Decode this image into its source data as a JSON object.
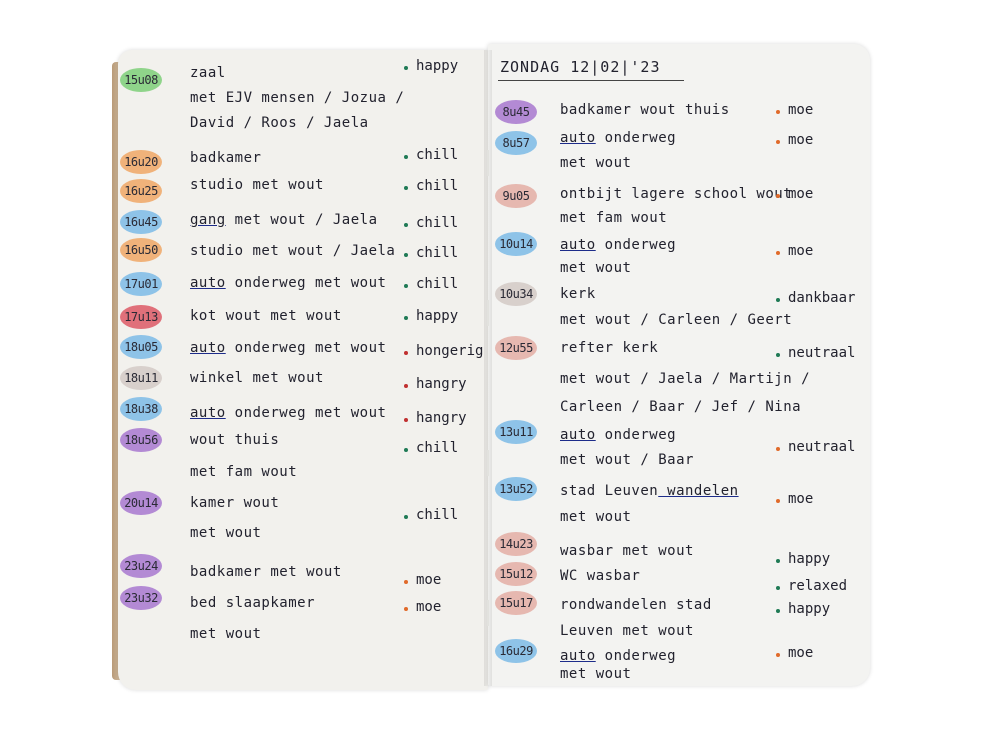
{
  "header": {
    "date": "ZONDAG   12|02|'23"
  },
  "colors": {
    "green": "#8fd48a",
    "orange": "#f0b27a",
    "blue": "#8ec3e8",
    "red": "#e0707a",
    "purple": "#b38ad4",
    "pink": "#e6b8b0",
    "grey": "#d8d0cc",
    "dot_green": "#1f7a55",
    "dot_orange": "#e06a2a",
    "dot_red": "#c03030"
  },
  "left_page": [
    {
      "time": "15u08",
      "lines": [
        "zaal",
        "met EJV mensen / Jozua /",
        "David / Roos / Jaela"
      ],
      "mood": "happy"
    },
    {
      "time": "16u20",
      "lines": [
        "badkamer"
      ],
      "mood": "chill"
    },
    {
      "time": "16u25",
      "lines": [
        "studio met wout"
      ],
      "mood": "chill"
    },
    {
      "time": "16u45",
      "lines": [
        "gang met wout / Jaela"
      ],
      "mood": "chill"
    },
    {
      "time": "16u50",
      "lines": [
        "studio met wout / Jaela"
      ],
      "mood": "chill"
    },
    {
      "time": "17u01",
      "lines": [
        "auto onderweg met wout"
      ],
      "mood": "chill"
    },
    {
      "time": "17u13",
      "lines": [
        "kot wout met wout"
      ],
      "mood": "happy"
    },
    {
      "time": "18u05",
      "lines": [
        "auto onderweg met wout"
      ],
      "mood": "hongerig"
    },
    {
      "time": "18u11",
      "lines": [
        "winkel met wout"
      ],
      "mood": "hangry"
    },
    {
      "time": "18u38",
      "lines": [
        "auto onderweg met wout"
      ],
      "mood": "hangry"
    },
    {
      "time": "18u56",
      "lines": [
        "wout thuis",
        "met fam wout"
      ],
      "mood": "chill"
    },
    {
      "time": "20u14",
      "lines": [
        "kamer wout",
        "met wout"
      ],
      "mood": "chill"
    },
    {
      "time": "23u24",
      "lines": [
        "badkamer met wout"
      ],
      "mood": "moe"
    },
    {
      "time": "23u32",
      "lines": [
        "bed slaapkamer",
        "met wout"
      ],
      "mood": "moe"
    }
  ],
  "right_page": [
    {
      "time": "8u45",
      "lines": [
        "badkamer wout thuis"
      ],
      "mood": "moe"
    },
    {
      "time": "8u57",
      "lines": [
        "auto onderweg",
        "met wout"
      ],
      "mood": "moe"
    },
    {
      "time": "9u05",
      "lines": [
        "ontbijt lagere school wout",
        "met fam wout"
      ],
      "mood": "moe"
    },
    {
      "time": "10u14",
      "lines": [
        "auto onderweg",
        "met wout"
      ],
      "mood": "moe"
    },
    {
      "time": "10u34",
      "lines": [
        "kerk",
        "met wout / Carleen / Geert"
      ],
      "mood": "dankbaar"
    },
    {
      "time": "12u55",
      "lines": [
        "refter kerk",
        "met wout / Jaela / Martijn /",
        "Carleen / Baar / Jef / Nina"
      ],
      "mood": "neutraal"
    },
    {
      "time": "13u11",
      "lines": [
        "auto onderweg",
        "met wout / Baar"
      ],
      "mood": "neutraal"
    },
    {
      "time": "13u52",
      "lines": [
        "stad Leuven wandelen",
        "met wout"
      ],
      "mood": "moe"
    },
    {
      "time": "14u23",
      "lines": [
        "wasbar met wout"
      ],
      "mood": "happy"
    },
    {
      "time": "15u12",
      "lines": [
        "WC wasbar"
      ],
      "mood": "relaxed"
    },
    {
      "time": "15u17",
      "lines": [
        "rondwandelen stad",
        "Leuven met wout"
      ],
      "mood": "happy"
    },
    {
      "time": "16u29",
      "lines": [
        "auto onderweg",
        "met wout"
      ],
      "mood": "moe"
    }
  ]
}
